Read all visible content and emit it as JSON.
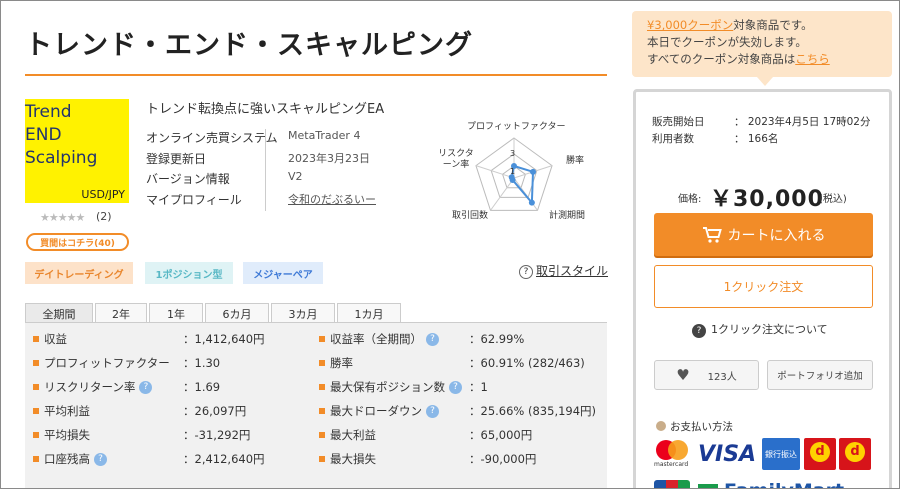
{
  "product": {
    "title": "トレンド・エンド・スキャルピング",
    "thumbnail_lines": [
      "Trend",
      "END",
      "Scalping"
    ],
    "thumbnail_pair": "USD/JPY",
    "stars": "★★★★★",
    "review_count": "(2)",
    "buy_label": "買間はコチラ(40)",
    "subtitle": "トレンド転換点に強いスキャルピングEA"
  },
  "info": {
    "rows": [
      {
        "label": "オンライン売買システム",
        "value": "MetaTrader 4"
      },
      {
        "label": "登録更新日",
        "value": "2023年3月23日"
      },
      {
        "label": "バージョン情報",
        "value": "V2"
      },
      {
        "label": "マイプロフィール",
        "value": "令和のだぶるいー"
      }
    ]
  },
  "radar": {
    "labels": [
      "プロフィットファクター",
      "勝率",
      "計測期間",
      "取引回数",
      "リスクターン率"
    ],
    "scale_marks": [
      "3",
      "1"
    ],
    "values": [
      1.5,
      2.5,
      3.8,
      0.3,
      0.3
    ],
    "max": 5,
    "line_color": "#4a90d9"
  },
  "tags": [
    "デイトレーディング",
    "1ポジション型",
    "メジャーペア"
  ],
  "trade_style_link": "取引スタイル",
  "tabs": [
    "全期間",
    "2年",
    "1年",
    "6カ月",
    "3カ月",
    "1カ月"
  ],
  "stats": {
    "left": [
      {
        "label": "収益",
        "value": "：1,412,640円"
      },
      {
        "label": "プロフィットファクター",
        "value": "：1.30"
      },
      {
        "label": "リスクリターン率",
        "value": "：1.69"
      },
      {
        "label": "平均利益",
        "value": "：26,097円"
      },
      {
        "label": "平均損失",
        "value": "：-31,292円"
      },
      {
        "label": "口座残高",
        "value": "：2,412,640円"
      }
    ],
    "right": [
      {
        "label": "収益率（全期間）",
        "value": "：62.99%"
      },
      {
        "label": "勝率",
        "value": "：60.91% (282/463)"
      },
      {
        "label": "最大保有ポジション数",
        "value": "：1"
      },
      {
        "label": "最大ドローダウン",
        "value": "：25.66% (835,194円)"
      },
      {
        "label": "最大利益",
        "value": "：65,000円"
      },
      {
        "label": "最大損失",
        "value": "：-90,000円"
      }
    ]
  },
  "notice": {
    "coupon": "¥3,000クーポン",
    "coupon_suffix": "対象商品です。",
    "line2": "本日でクーポンが失効します。",
    "line3_prefix": "すべてのクーポン対象商品は",
    "line3_link": "こちら"
  },
  "sales": {
    "start_label": "販売開始日",
    "start_value": "：  2023年4月5日  17時02分",
    "users_label": "利用者数",
    "users_value": "：  166名"
  },
  "price": {
    "label": "価格:",
    "value": "￥30,000",
    "tax": "(税込)"
  },
  "buttons": {
    "cart": "カートに入れる",
    "oneclick": "1クリック注文",
    "oneclick_about": "1クリック注文について",
    "like_count": "123人",
    "portfolio": "ポートフォリオ追加"
  },
  "payment": {
    "heading": "お支払い方法",
    "mastercard": "mastercard",
    "visa": "VISA",
    "bank": "銀行振込",
    "familymart": "FamilyMart"
  },
  "colors": {
    "accent": "#f28c28",
    "thumb_bg": "#fff200",
    "notice_bg": "#fde5c9"
  }
}
